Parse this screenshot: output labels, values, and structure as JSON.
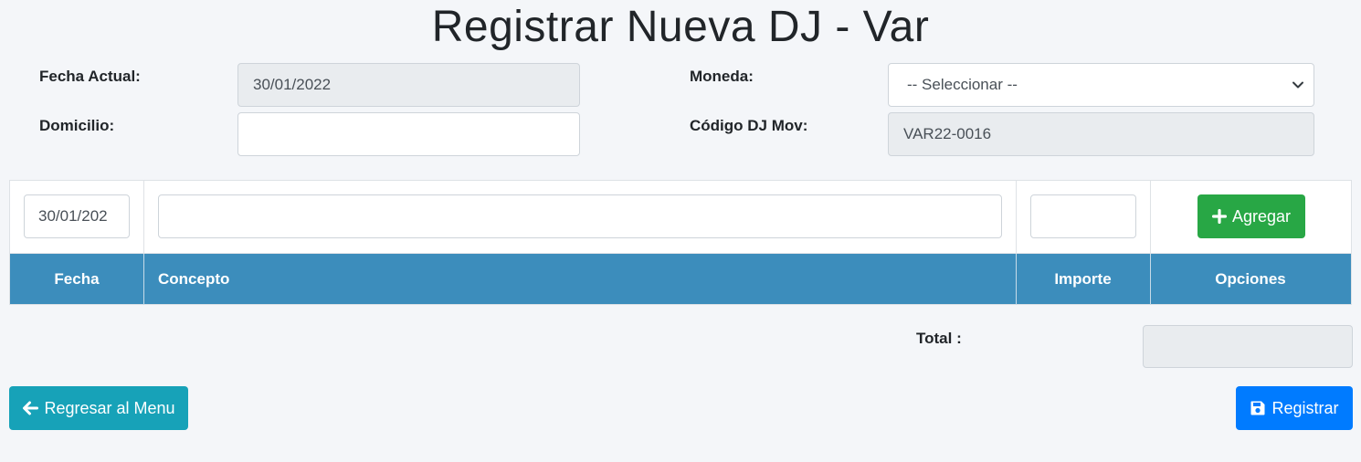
{
  "title": "Registrar Nueva DJ - Var",
  "form": {
    "fecha_actual_label": "Fecha Actual:",
    "fecha_actual_value": "30/01/2022",
    "domicilio_label": "Domicilio:",
    "domicilio_value": "",
    "moneda_label": "Moneda:",
    "moneda_selected": "-- Seleccionar --",
    "codigo_label": "Código DJ Mov:",
    "codigo_value": "VAR22-0016"
  },
  "entry_row": {
    "fecha_value": "30/01/202",
    "concepto_value": "",
    "importe_value": "",
    "add_button_label": "Agregar"
  },
  "table": {
    "columns": [
      "Fecha",
      "Concepto",
      "Importe",
      "Opciones"
    ],
    "rows": [],
    "header_color": "#3c8dbc"
  },
  "total": {
    "label": "Total :",
    "value": ""
  },
  "buttons": {
    "back_label": "Regresar al Menu",
    "save_label": "Registrar"
  },
  "colors": {
    "success": "#28a745",
    "info": "#17a2b8",
    "primary": "#007bff"
  },
  "icons": {
    "add": "plus-icon",
    "back": "arrow-left-icon",
    "save": "floppy-disk-icon",
    "select": "chevron-down-icon"
  }
}
